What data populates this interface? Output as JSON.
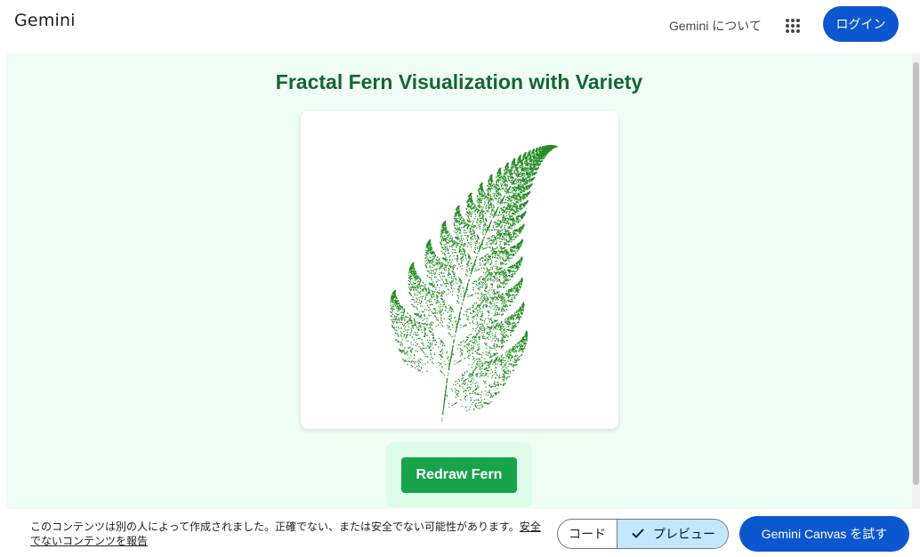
{
  "header": {
    "brand": "Gemini",
    "about_link": "Gemini について",
    "apps_icon": "apps-grid-icon",
    "login_label": "ログイン"
  },
  "canvas": {
    "title": "Fractal Fern Visualization with Variety",
    "redraw_label": "Redraw Fern",
    "fern_color": "#228b22",
    "background_color": "#f0fdf4",
    "title_color": "#166534",
    "button_color": "#16a34a"
  },
  "footer": {
    "notice_text": "このコンテンツは別の人によって作成されました。正確でない、または安全でない可能性があります。",
    "report_link": "安全でないコンテンツを報告",
    "code_label": "コード",
    "preview_label": "プレビュー",
    "check_icon": "check-icon",
    "try_label": "Gemini Canvas を試す"
  },
  "colors": {
    "accent": "#0b57d0",
    "toggle_selected": "#c2e7ff"
  }
}
